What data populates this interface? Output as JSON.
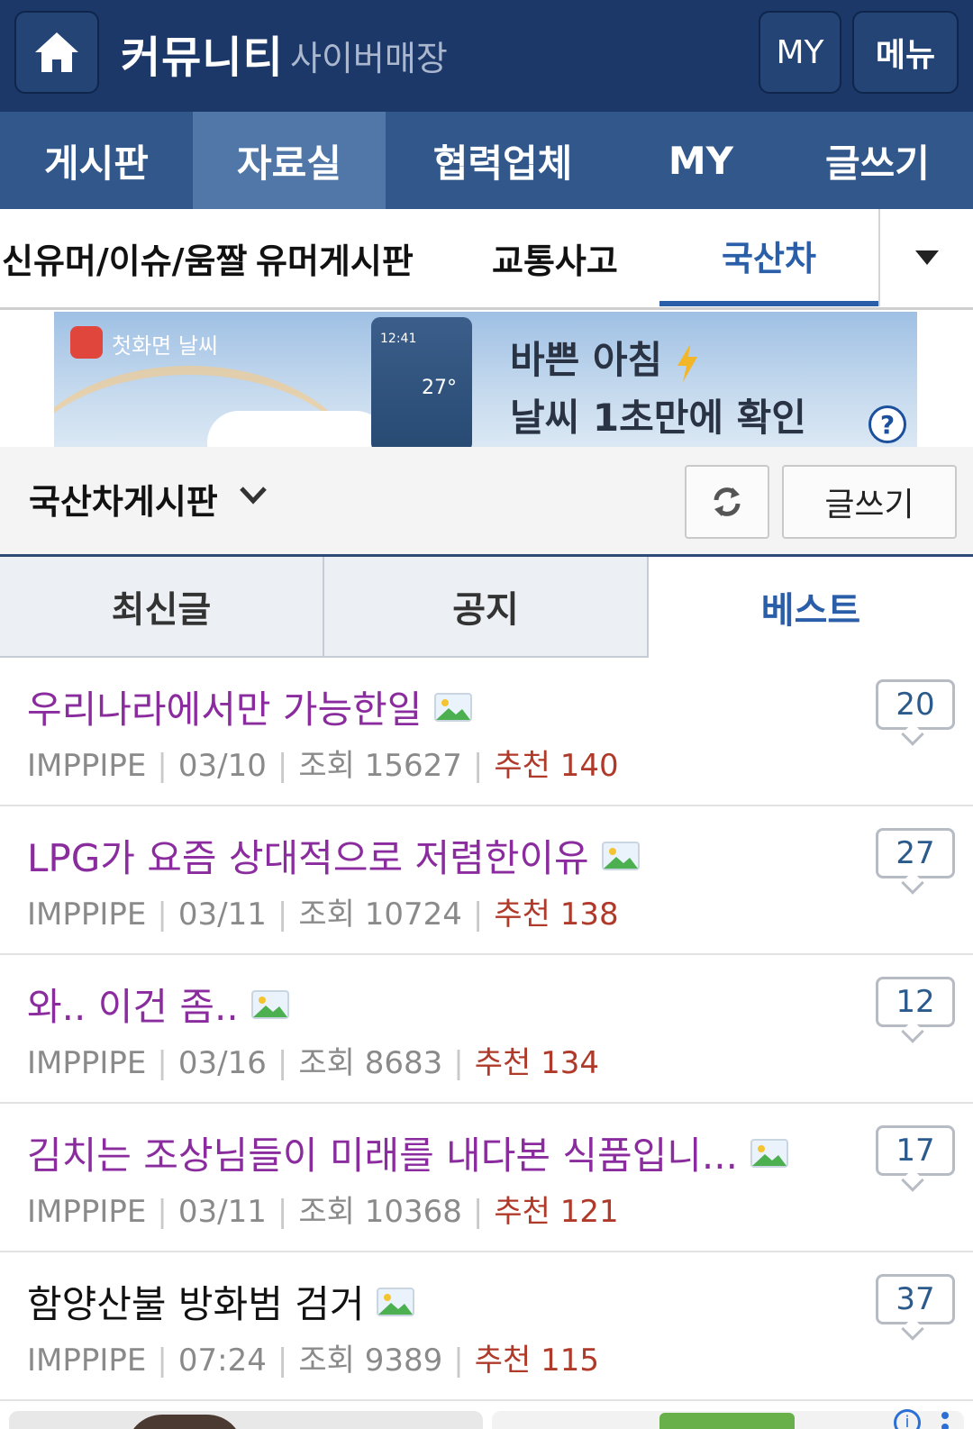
{
  "header": {
    "title": "커뮤니티",
    "subtitle": "사이버매장",
    "my_label": "MY",
    "menu_label": "메뉴",
    "home_icon": "home-icon"
  },
  "main_nav": {
    "items": [
      {
        "label": "게시판",
        "active": false
      },
      {
        "label": "자료실",
        "active": true
      },
      {
        "label": "협력업체",
        "active": false
      },
      {
        "label": "MY",
        "active": false
      },
      {
        "label": "글쓰기",
        "active": false
      }
    ]
  },
  "sub_nav": {
    "items": [
      {
        "label": "신유머/이슈/움짤",
        "active": false
      },
      {
        "label": "유머게시판",
        "active": false
      },
      {
        "label": "교통사고",
        "active": false
      },
      {
        "label": "국산차",
        "active": true
      }
    ],
    "dropdown_icon": "caret-down-icon"
  },
  "banner": {
    "app_name": "첫화면 날씨",
    "phone_time": "12:41",
    "phone_temp": "27°",
    "line1": "바쁜 아침",
    "line2": "날씨 1초만에 확인",
    "help_label": "?"
  },
  "board": {
    "title": "국산차게시판",
    "write_label": "글쓰기",
    "refresh_icon": "refresh-icon"
  },
  "tabs": [
    {
      "label": "최신글",
      "active": false
    },
    {
      "label": "공지",
      "active": false
    },
    {
      "label": "베스트",
      "active": true
    }
  ],
  "posts": [
    {
      "title": "우리나라에서만 가능한일",
      "author": "IMPPIPE",
      "date": "03/10",
      "views_label": "조회",
      "views": "15627",
      "rec_label": "추천",
      "rec": "140",
      "comments": "20",
      "visited": true
    },
    {
      "title": "LPG가 요즘 상대적으로 저렴한이유",
      "author": "IMPPIPE",
      "date": "03/11",
      "views_label": "조회",
      "views": "10724",
      "rec_label": "추천",
      "rec": "138",
      "comments": "27",
      "visited": true
    },
    {
      "title": "와.. 이건 좀..",
      "author": "IMPPIPE",
      "date": "03/16",
      "views_label": "조회",
      "views": "8683",
      "rec_label": "추천",
      "rec": "134",
      "comments": "12",
      "visited": true
    },
    {
      "title": "김치는 조상님들이 미래를 내다본 식품입니...",
      "author": "IMPPIPE",
      "date": "03/11",
      "views_label": "조회",
      "views": "10368",
      "rec_label": "추천",
      "rec": "121",
      "comments": "17",
      "visited": true
    },
    {
      "title": "함양산불 방화범 검거",
      "author": "IMPPIPE",
      "date": "07:24",
      "views_label": "조회",
      "views": "9389",
      "rec_label": "추천",
      "rec": "115",
      "comments": "37",
      "visited": false
    }
  ],
  "colors": {
    "header_bg": "#1c3868",
    "nav_bg": "#31578b",
    "accent": "#2b5ea8",
    "visited_title": "#8a2b9e",
    "recommend": "#b03a2a"
  }
}
